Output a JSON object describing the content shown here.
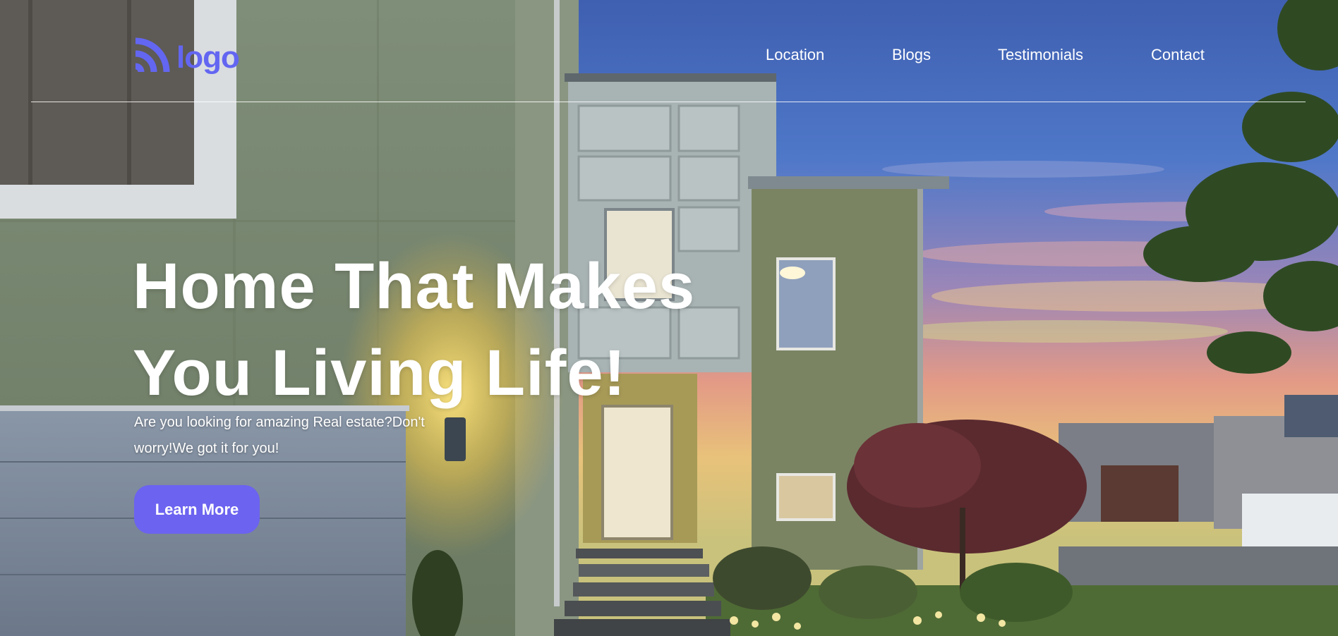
{
  "header": {
    "logo_text": "logo",
    "logo_icon": "wifi-arcs-icon",
    "nav": [
      {
        "label": "Location"
      },
      {
        "label": "Blogs"
      },
      {
        "label": "Testimonials"
      },
      {
        "label": "Contact"
      }
    ]
  },
  "hero": {
    "headline": "Home That Makes You Living Life!",
    "subtitle": "Are you looking for amazing Real estate?Don't worry!We got it for you!",
    "cta_label": "Learn More",
    "background": "house-at-dusk-photo"
  },
  "colors": {
    "brand": "#6366f1",
    "cta_bg": "#6c63f0",
    "text": "#ffffff"
  }
}
